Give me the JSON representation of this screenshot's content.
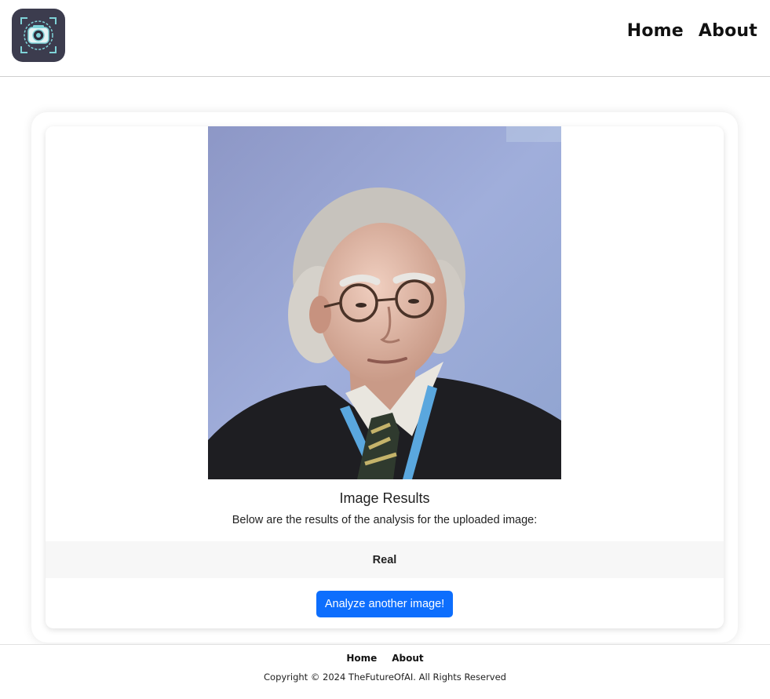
{
  "header": {
    "logo_icon": "camera-lens-scan-icon",
    "nav": [
      {
        "label": "Home"
      },
      {
        "label": "About"
      }
    ]
  },
  "result": {
    "photo_icon": "portrait-photo",
    "title": "Image Results",
    "description": "Below are the results of the analysis for the uploaded image:",
    "verdict": "Real",
    "button_label": "Analyze another image!"
  },
  "footer": {
    "nav": [
      {
        "label": "Home"
      },
      {
        "label": "About"
      }
    ],
    "copyright": "Copyright © 2024 TheFutureOfAI. All Rights Reserved"
  },
  "colors": {
    "logo_bg": "#3c3c4e",
    "logo_accent": "#7fd3d8",
    "button_bg": "#0d6efd",
    "band_bg": "#f7f7f7"
  }
}
